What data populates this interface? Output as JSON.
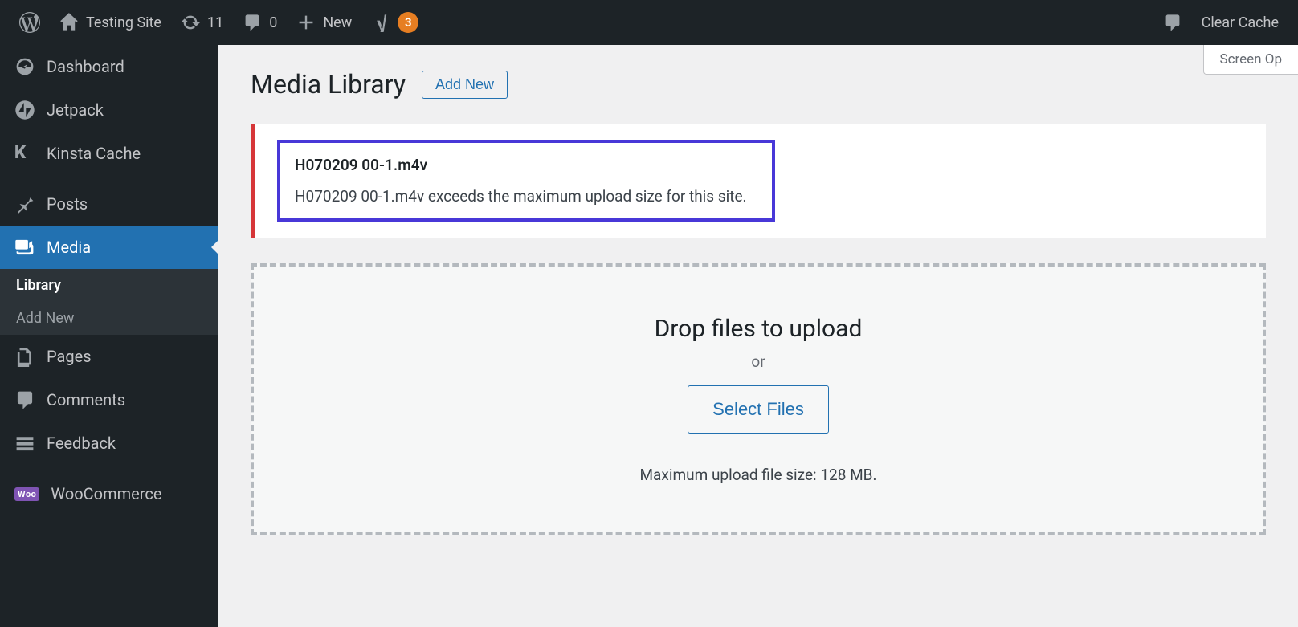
{
  "adminBar": {
    "siteName": "Testing Site",
    "updatesCount": "11",
    "commentsCount": "0",
    "newLabel": "New",
    "yoastBadge": "3",
    "clearCache": "Clear Cache"
  },
  "sidebar": {
    "dashboard": "Dashboard",
    "jetpack": "Jetpack",
    "kinstaCache": "Kinsta Cache",
    "posts": "Posts",
    "media": "Media",
    "library": "Library",
    "addNew": "Add New",
    "pages": "Pages",
    "comments": "Comments",
    "feedback": "Feedback",
    "woocommerce": "WooCommerce"
  },
  "main": {
    "screenOptions": "Screen Op",
    "title": "Media Library",
    "addNewBtn": "Add New",
    "error": {
      "filename": "H070209 00-1.m4v",
      "message": "H070209 00-1.m4v exceeds the maximum upload size for this site."
    },
    "upload": {
      "dropText": "Drop files to upload",
      "or": "or",
      "selectFiles": "Select Files",
      "limit": "Maximum upload file size: 128 MB."
    }
  }
}
